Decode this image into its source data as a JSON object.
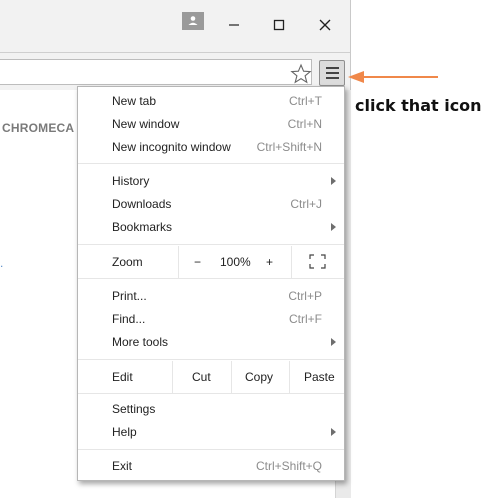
{
  "page": {
    "heading": "CHROMECA",
    "dot": "."
  },
  "menu": {
    "group1": [
      {
        "label": "New tab",
        "shortcut": "Ctrl+T"
      },
      {
        "label": "New window",
        "shortcut": "Ctrl+N"
      },
      {
        "label": "New incognito window",
        "shortcut": "Ctrl+Shift+N"
      }
    ],
    "group2": [
      {
        "label": "History",
        "shortcut": ""
      },
      {
        "label": "Downloads",
        "shortcut": "Ctrl+J"
      },
      {
        "label": "Bookmarks",
        "shortcut": ""
      }
    ],
    "zoom": {
      "label": "Zoom",
      "minus": "−",
      "value": "100%",
      "plus": "+"
    },
    "group3": [
      {
        "label": "Print...",
        "shortcut": "Ctrl+P"
      },
      {
        "label": "Find...",
        "shortcut": "Ctrl+F"
      },
      {
        "label": "More tools",
        "shortcut": ""
      }
    ],
    "edit": {
      "label": "Edit",
      "cut": "Cut",
      "copy": "Copy",
      "paste": "Paste"
    },
    "group4": [
      {
        "label": "Settings",
        "shortcut": ""
      },
      {
        "label": "Help",
        "shortcut": ""
      }
    ],
    "exit": {
      "label": "Exit",
      "shortcut": "Ctrl+Shift+Q"
    }
  },
  "annotation": {
    "text": "click that icon",
    "color": "#f0884a"
  },
  "icons": {
    "profile": "profile-icon",
    "minimize": "minimize-icon",
    "maximize": "maximize-icon",
    "close": "close-icon",
    "star": "star-icon",
    "menu": "hamburger-menu-icon",
    "fullscreen": "fullscreen-icon"
  }
}
